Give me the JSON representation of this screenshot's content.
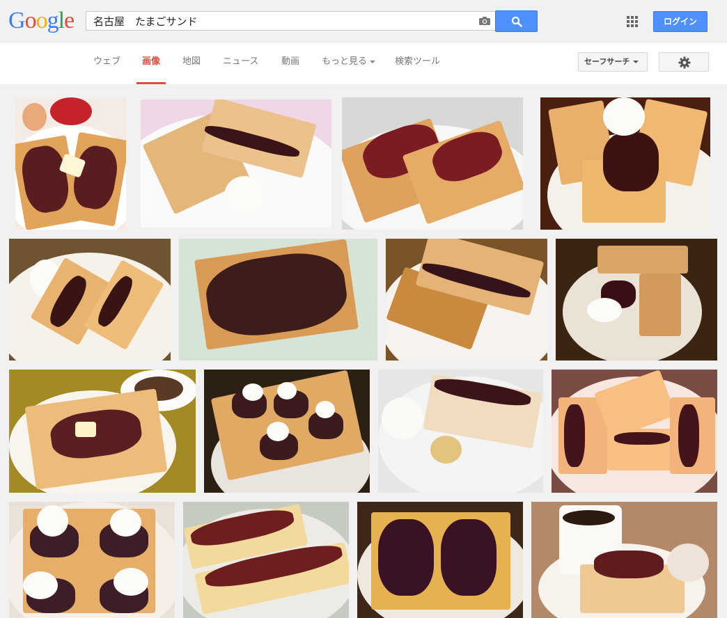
{
  "logo": {
    "letters": [
      "G",
      "o",
      "o",
      "g",
      "l",
      "e"
    ]
  },
  "search": {
    "query": "名古屋　たまごサンド"
  },
  "header": {
    "login_label": "ログイン"
  },
  "nav": {
    "tabs": [
      {
        "label": "ウェブ",
        "active": false
      },
      {
        "label": "画像",
        "active": true
      },
      {
        "label": "地図",
        "active": false
      },
      {
        "label": "ニュース",
        "active": false
      },
      {
        "label": "動画",
        "active": false
      },
      {
        "label": "もっと見る",
        "active": false,
        "dropdown": true
      },
      {
        "label": "検索ツール",
        "active": false
      }
    ],
    "safesearch_label": "セーフサーチ"
  },
  "colors": {
    "accent_blue": "#4d90fe",
    "active_tab_red": "#dd4b39",
    "toast": "#e9b46c",
    "anko": "#4a1a1c"
  },
  "icons": [
    "camera-icon",
    "search-icon",
    "apps-grid-icon",
    "chevron-down-icon",
    "gear-icon"
  ],
  "results": {
    "image_count": 16
  }
}
